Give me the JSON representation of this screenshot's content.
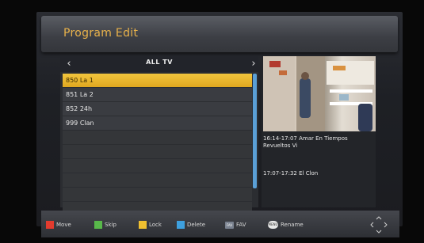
{
  "title": "Program Edit",
  "list": {
    "group": "ALL TV",
    "channels": [
      "850 La 1",
      "851 La 2",
      "852 24h",
      "999 Clan"
    ],
    "selected_index": 0,
    "empty_rows": 6
  },
  "preview": {
    "epg": [
      "16:14-17:07  Amar En Tiempos Revueltos Vi",
      "17:07-17:32  El Clon"
    ]
  },
  "footer": {
    "move": "Move",
    "skip": "Skip",
    "lock": "Lock",
    "delete": "Delete",
    "fav_badge": "FAV",
    "fav": "FAV",
    "menu_badge": "MENU",
    "rename": "Rename"
  },
  "colors": {
    "accent": "#e9b24a",
    "selected_row": "#e8b52a",
    "red": "#e23b2e",
    "green": "#58b84a",
    "yellow": "#f0c030",
    "blue": "#3ea0df",
    "scrollbar": "#5a9fd6"
  },
  "icons": {
    "nav": "dpad-arrows-icon",
    "prev": "chevron-left-icon",
    "next": "chevron-right-icon"
  }
}
